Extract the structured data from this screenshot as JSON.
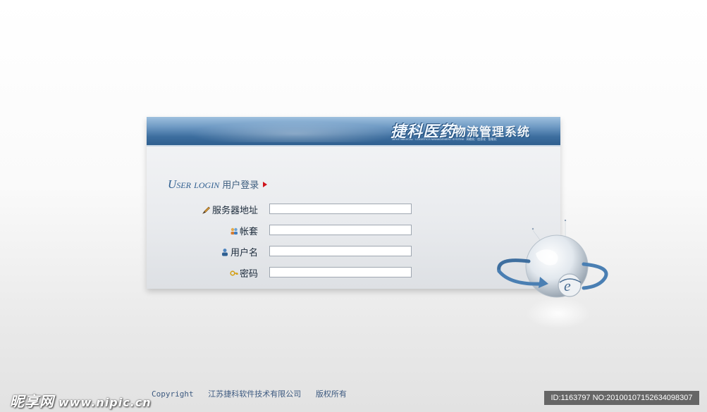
{
  "header": {
    "brand": "捷科医药",
    "system_name": "物流管理系统",
    "tagline": "JIEKE MEDICAL · LOGISTICS MANAGEMENT SYSTEM · 网络化 · 信息化 · 智能化"
  },
  "login": {
    "title_en": "User login",
    "title_cn": "用户登录",
    "fields": [
      {
        "label": "服务器地址",
        "icon": "pencil-icon",
        "value": ""
      },
      {
        "label": "帐套",
        "icon": "users-icon",
        "value": ""
      },
      {
        "label": "用户名",
        "icon": "user-icon",
        "value": ""
      },
      {
        "label": "密码",
        "icon": "key-icon",
        "value": ""
      }
    ]
  },
  "footer": {
    "copyright": "Copyright",
    "company": "江苏捷科软件技术有限公司",
    "rights": "版权所有"
  },
  "watermark": {
    "site_name": "昵享网",
    "site_url": "www.nipic.cn",
    "image_id": "ID:1163797 NO:20100107152634098307"
  },
  "colors": {
    "banner": "#3d6e9f",
    "title_text": "#2f5f90",
    "arrow": "#d0141c"
  }
}
